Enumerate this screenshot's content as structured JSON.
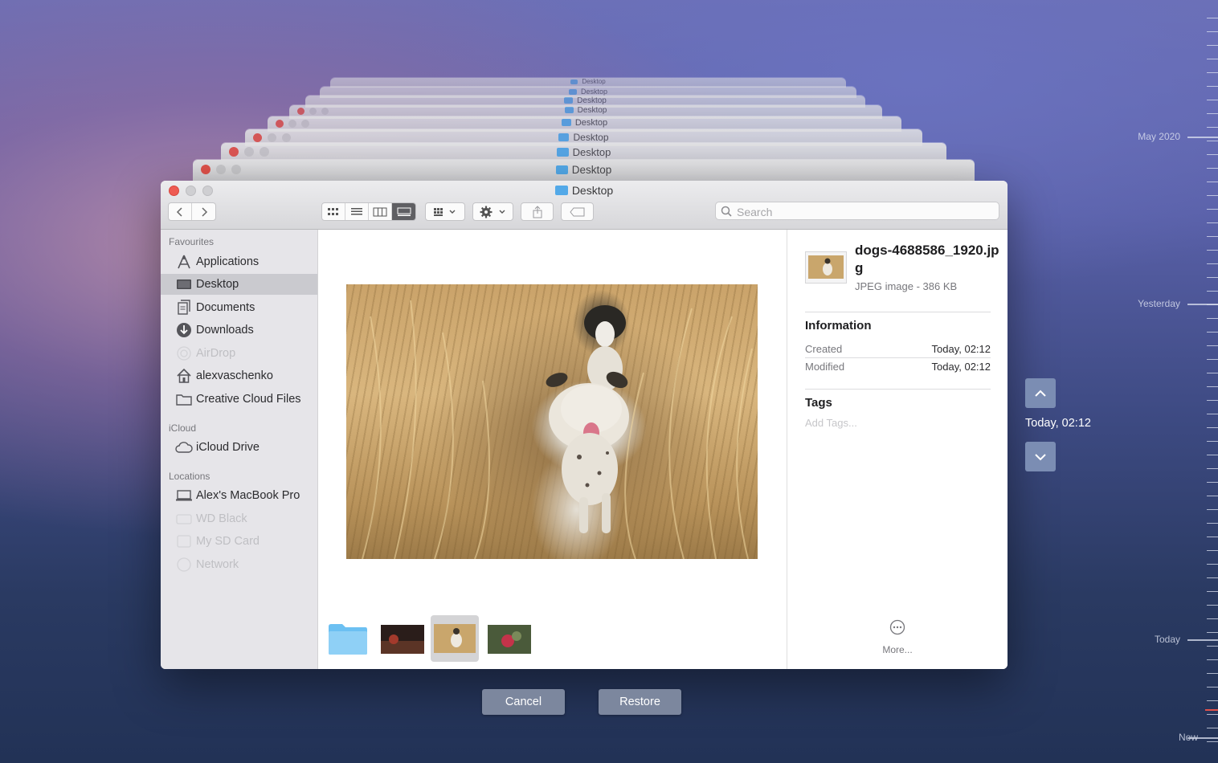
{
  "window": {
    "title": "Desktop"
  },
  "stack_title": "Desktop",
  "toolbar": {
    "search_placeholder": "Search"
  },
  "sidebar": {
    "sections": [
      {
        "heading": "Favourites",
        "items": [
          {
            "label": "Applications",
            "icon": "applications-icon",
            "selected": false,
            "dim": false
          },
          {
            "label": "Desktop",
            "icon": "desktop-icon",
            "selected": true,
            "dim": false
          },
          {
            "label": "Documents",
            "icon": "documents-icon",
            "selected": false,
            "dim": false
          },
          {
            "label": "Downloads",
            "icon": "downloads-icon",
            "selected": false,
            "dim": false
          },
          {
            "label": "AirDrop",
            "icon": "airdrop-icon",
            "selected": false,
            "dim": true
          },
          {
            "label": "alexvaschenko",
            "icon": "home-icon",
            "selected": false,
            "dim": false
          },
          {
            "label": "Creative Cloud Files",
            "icon": "folder-icon",
            "selected": false,
            "dim": false
          }
        ]
      },
      {
        "heading": "iCloud",
        "items": [
          {
            "label": "iCloud Drive",
            "icon": "cloud-icon",
            "selected": false,
            "dim": false
          }
        ]
      },
      {
        "heading": "Locations",
        "items": [
          {
            "label": "Alex's MacBook Pro",
            "icon": "laptop-icon",
            "selected": false,
            "dim": false
          },
          {
            "label": "WD Black",
            "icon": "drive-icon",
            "selected": false,
            "dim": true
          },
          {
            "label": "My SD Card",
            "icon": "sd-card-icon",
            "selected": false,
            "dim": true
          },
          {
            "label": "Network",
            "icon": "network-icon",
            "selected": false,
            "dim": true
          }
        ]
      }
    ]
  },
  "inspector": {
    "file_name": "dogs-4688586_1920.jpg",
    "file_type": "JPEG image - 386 KB",
    "info_heading": "Information",
    "created_label": "Created",
    "created_value": "Today, 02:12",
    "modified_label": "Modified",
    "modified_value": "Today, 02:12",
    "tags_heading": "Tags",
    "tags_placeholder": "Add Tags...",
    "more_label": "More..."
  },
  "actions": {
    "cancel": "Cancel",
    "restore": "Restore"
  },
  "time_machine": {
    "current_time": "Today, 02:12",
    "timeline_labels": [
      "May 2020",
      "Yesterday",
      "Today",
      "Now"
    ]
  },
  "colors": {
    "accent": "#7b8db3",
    "selection": "#cacacf",
    "close": "#ee5a52"
  }
}
